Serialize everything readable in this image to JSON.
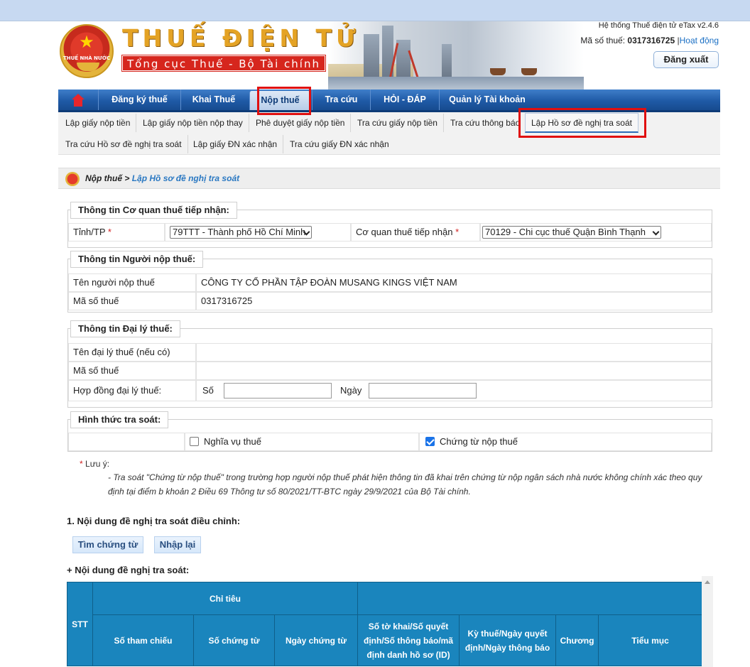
{
  "header": {
    "emblem_text": "THUẾ NHÀ NƯỚC",
    "brand_title": "THUẾ ĐIỆN TỬ",
    "brand_subtitle": "Tổng cục Thuế - Bộ Tài chính",
    "system_version": "Hệ thống Thuế điện tử eTax v2.4.6",
    "mst_label": "Mã số thuế:",
    "mst_value": "0317316725",
    "separator": "|",
    "activity_link": "Hoạt động",
    "logout_label": "Đăng xuất"
  },
  "nav": {
    "items": [
      {
        "label": "Đăng ký thuế"
      },
      {
        "label": "Khai Thuế"
      },
      {
        "label": "Nộp thuế"
      },
      {
        "label": "Tra cứu"
      },
      {
        "label": "HỎI - ĐÁP"
      },
      {
        "label": "Quản lý Tài khoản"
      }
    ]
  },
  "subnav": {
    "items": [
      {
        "label": "Lập giấy nộp tiền"
      },
      {
        "label": "Lập giấy nộp tiền nộp thay"
      },
      {
        "label": "Phê duyệt giấy nộp tiền"
      },
      {
        "label": "Tra cứu giấy nộp tiền"
      },
      {
        "label": "Tra cứu thông báo"
      },
      {
        "label": "Lập Hồ sơ đề nghị tra soát"
      },
      {
        "label": "Tra cứu Hồ sơ đề nghị tra soát"
      },
      {
        "label": "Lập giấy ĐN xác nhận"
      },
      {
        "label": "Tra cứu giấy ĐN xác nhận"
      }
    ]
  },
  "breadcrumb": {
    "parent": "Nộp thuế",
    "separator": ">",
    "current": "Lập Hồ sơ đề nghị tra soát"
  },
  "agency": {
    "legend": "Thông tin Cơ quan thuế tiếp nhận:",
    "province_label": "Tỉnh/TP",
    "province_value": "79TTT - Thành phố Hồ Chí Minh",
    "office_label": "Cơ quan thuế tiếp nhận",
    "office_value": "70129 - Chi cục thuế Quận Bình Thạnh",
    "required_mark": "*"
  },
  "taxpayer": {
    "legend": "Thông tin Người nộp thuế:",
    "name_label": "Tên người nộp thuế",
    "name_value": "CÔNG TY CỔ PHẦN TẬP ĐOÀN MUSANG KINGS VIỆT NAM",
    "mst_label": "Mã số thuế",
    "mst_value": "0317316725"
  },
  "agent": {
    "legend": "Thông tin Đại lý thuế:",
    "name_label": "Tên đại lý thuế (nếu có)",
    "mst_label": "Mã số thuế",
    "contract_label": "Hợp đồng đại lý thuế:",
    "number_label": "Số",
    "date_label": "Ngày",
    "number_value": "",
    "date_value": ""
  },
  "review_form": {
    "legend": "Hình thức tra soát:",
    "option1": "Nghĩa vụ thuế",
    "option1_checked": false,
    "option2": "Chứng từ nộp thuế",
    "option2_checked": true
  },
  "note": {
    "label": "Lưu ý:",
    "text": "- Tra soát \"Chứng từ nộp thuế\" trong trường hợp người nộp thuế phát hiện thông tin đã khai trên chứng từ nộp ngân sách nhà nước không chính xác theo quy định tại điểm b khoản 2 Điều 69 Thông tư số 80/2021/TT-BTC ngày 29/9/2021 của Bộ Tài chính."
  },
  "section": {
    "title": "1. Nội dung đề nghị tra soát điều chỉnh:",
    "search_button": "Tìm chứng từ",
    "reset_button": "Nhập lại",
    "content_title": "+ Nội dung đề nghị tra soát:"
  },
  "table": {
    "stt": "STT",
    "group": "Chỉ tiêu",
    "columns": [
      "Số tham chiếu",
      "Số chứng từ",
      "Ngày chứng từ",
      "Số tờ khai/Số quyết định/Số thông báo/mã định danh hồ sơ (ID)",
      "Kỳ thuế/Ngày quyết định/Ngày thông báo",
      "Chương",
      "Tiểu mục"
    ]
  },
  "colors": {
    "nav_blue": "#1f5aa6",
    "table_header": "#1a85bd",
    "highlight_red": "#e01010",
    "link_blue": "#1a6fc4"
  }
}
